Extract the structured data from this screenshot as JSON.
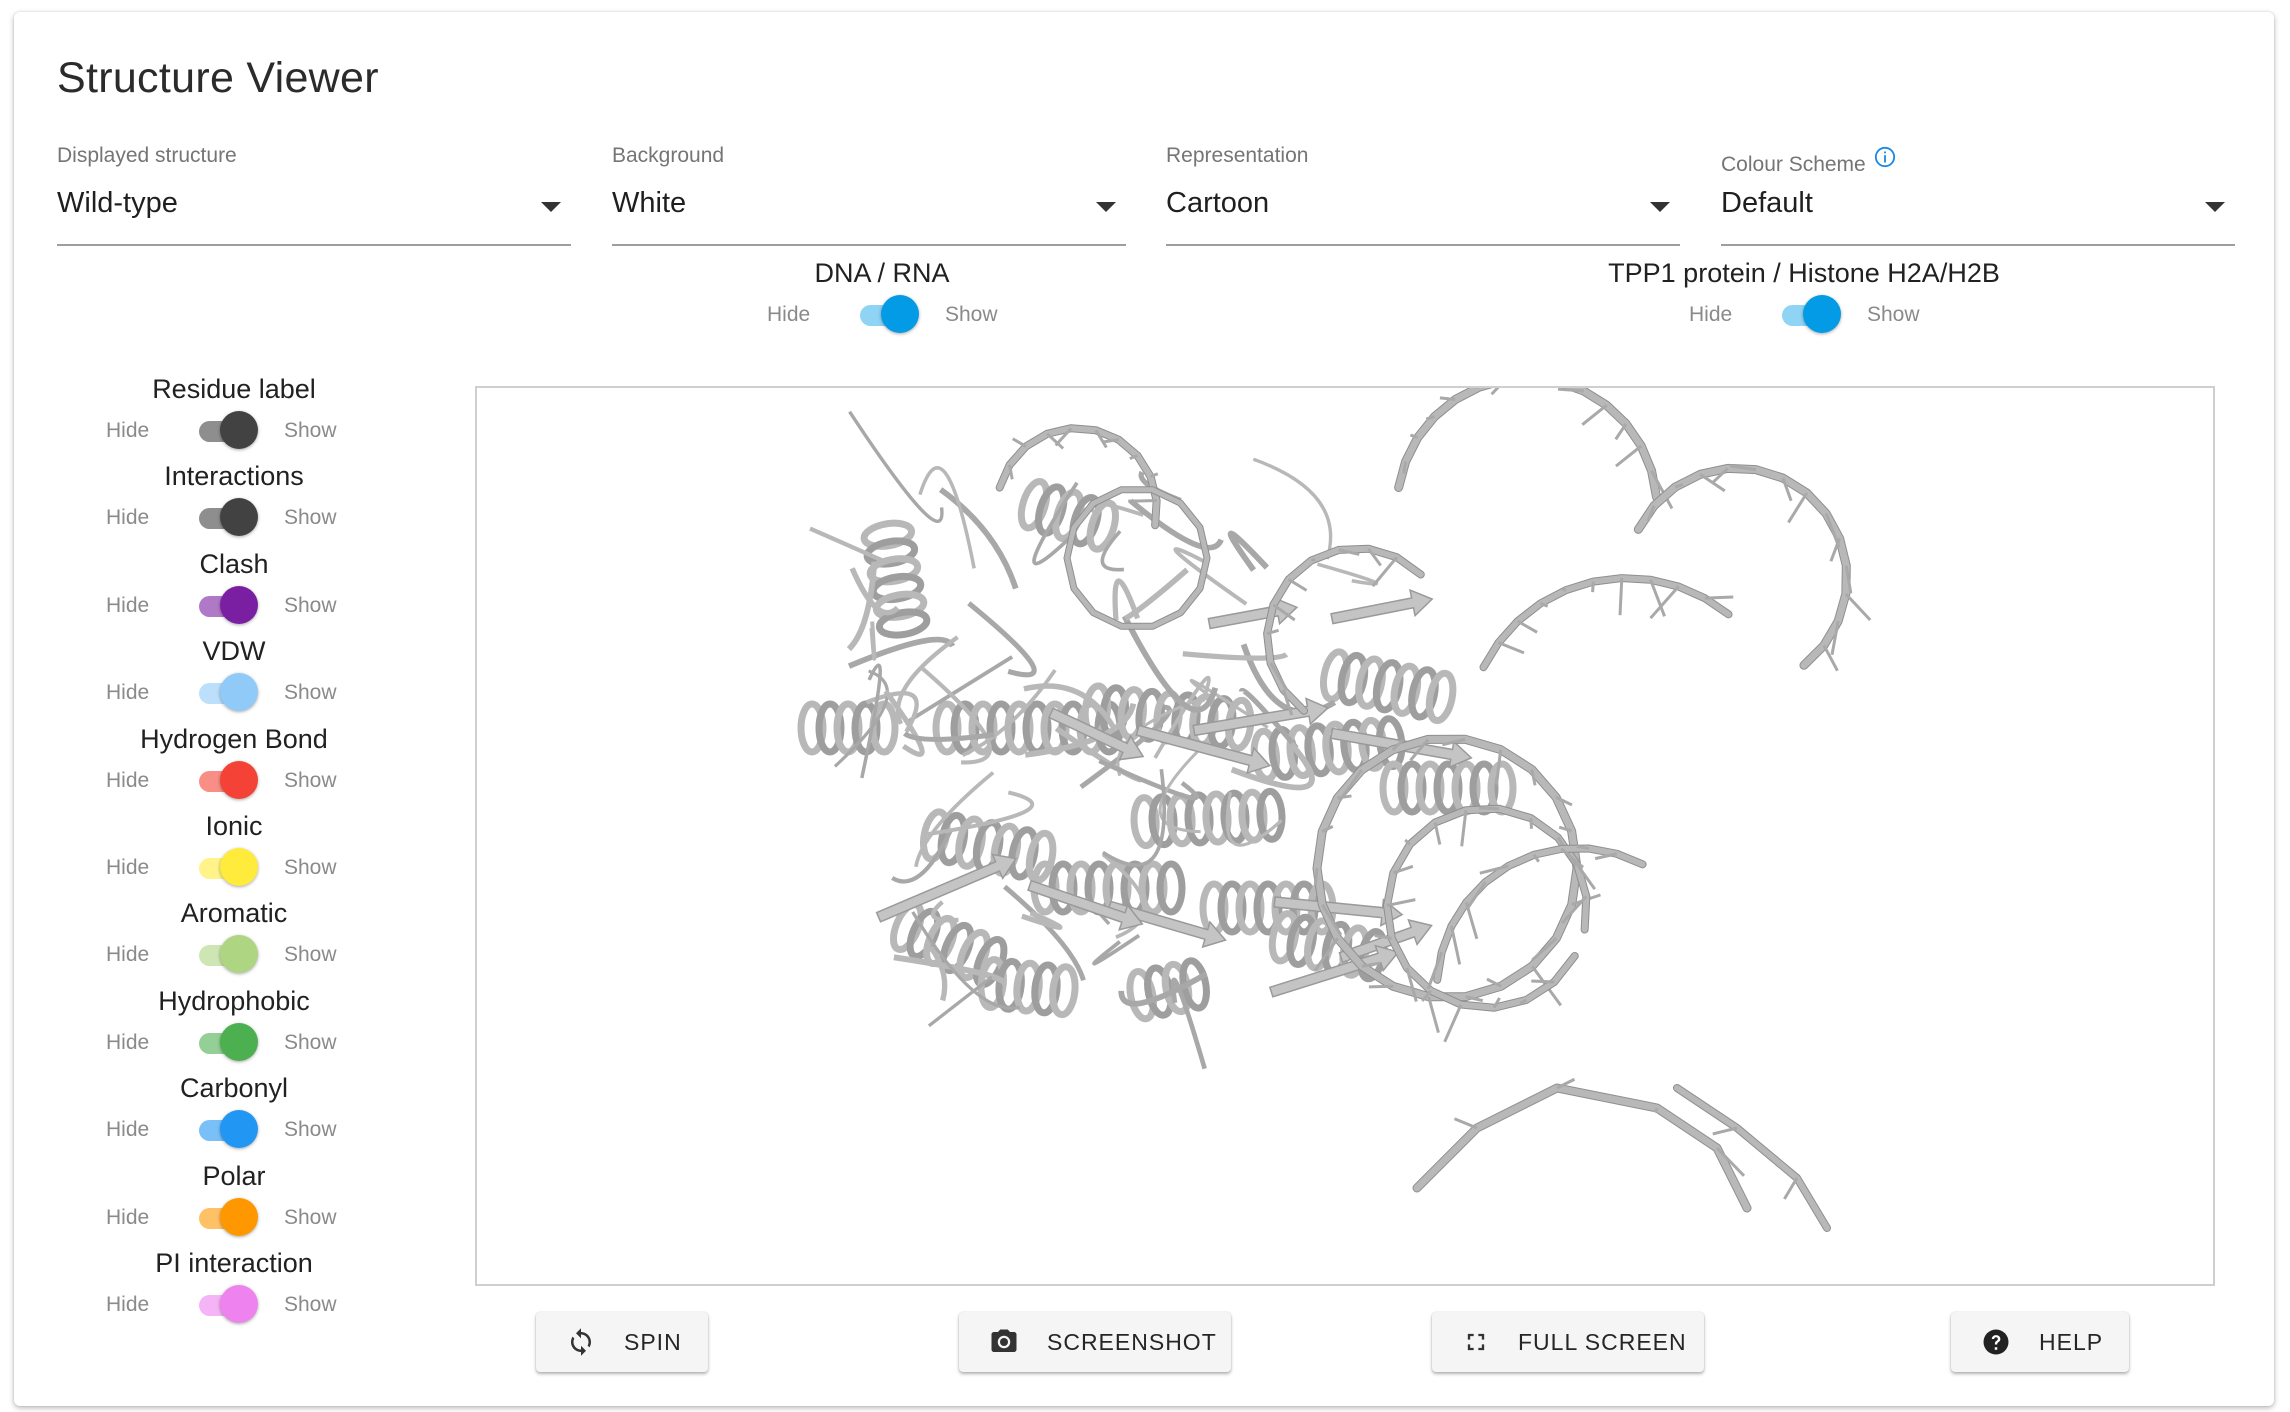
{
  "page": {
    "title": "Structure Viewer"
  },
  "selects": {
    "displayed_structure": {
      "label": "Displayed structure",
      "value": "Wild-type"
    },
    "background": {
      "label": "Background",
      "value": "White"
    },
    "representation": {
      "label": "Representation",
      "value": "Cartoon"
    },
    "colour_scheme": {
      "label": "Colour Scheme",
      "value": "Default",
      "info_icon": "info-icon"
    }
  },
  "top_toggles": {
    "dna_rna": {
      "title": "DNA / RNA",
      "off": "Hide",
      "on": "Show",
      "enabled": true,
      "color": "#039be5"
    },
    "tpp1": {
      "title": "TPP1 protein / Histone H2A/H2B",
      "off": "Hide",
      "on": "Show",
      "enabled": true,
      "color": "#039be5"
    }
  },
  "side_toggles": [
    {
      "title": "Residue label",
      "off": "Hide",
      "on": "Show",
      "enabled": true,
      "color": "#424242"
    },
    {
      "title": "Interactions",
      "off": "Hide",
      "on": "Show",
      "enabled": true,
      "color": "#424242"
    },
    {
      "title": "Clash",
      "off": "Hide",
      "on": "Show",
      "enabled": true,
      "color": "#7b1fa2"
    },
    {
      "title": "VDW",
      "off": "Hide",
      "on": "Show",
      "enabled": true,
      "color": "#90caf9"
    },
    {
      "title": "Hydrogen Bond",
      "off": "Hide",
      "on": "Show",
      "enabled": true,
      "color": "#f44336"
    },
    {
      "title": "Ionic",
      "off": "Hide",
      "on": "Show",
      "enabled": true,
      "color": "#ffeb3b"
    },
    {
      "title": "Aromatic",
      "off": "Hide",
      "on": "Show",
      "enabled": true,
      "color": "#aed581"
    },
    {
      "title": "Hydrophobic",
      "off": "Hide",
      "on": "Show",
      "enabled": true,
      "color": "#4caf50"
    },
    {
      "title": "Carbonyl",
      "off": "Hide",
      "on": "Show",
      "enabled": true,
      "color": "#2196f3"
    },
    {
      "title": "Polar",
      "off": "Hide",
      "on": "Show",
      "enabled": true,
      "color": "#ff9800"
    },
    {
      "title": "PI interaction",
      "off": "Hide",
      "on": "Show",
      "enabled": true,
      "color": "#ee82ee"
    }
  ],
  "buttons": {
    "spin": {
      "label": "SPIN",
      "icon": "sync-icon"
    },
    "screenshot": {
      "label": "SCREENSHOT",
      "icon": "camera-icon"
    },
    "fullscreen": {
      "label": "FULL SCREEN",
      "icon": "fullscreen-icon"
    },
    "help": {
      "label": "HELP",
      "icon": "help-icon"
    }
  },
  "viewer": {
    "structure_color": "#b8b8b8"
  }
}
